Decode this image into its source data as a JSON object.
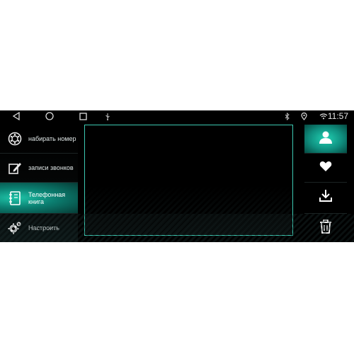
{
  "statusbar": {
    "time": "11:57",
    "icons": [
      "back-icon",
      "home-icon",
      "recent-apps-icon",
      "usb-icon",
      "bluetooth-icon",
      "location-icon",
      "wifi-icon"
    ]
  },
  "menu": {
    "items": [
      {
        "label": "набирать номер",
        "icon": "dialpad-icon",
        "active": false
      },
      {
        "label": "записи звонков",
        "icon": "edit-icon",
        "active": false
      },
      {
        "label": "Телефонная книга",
        "icon": "phonebook-icon",
        "active": true
      },
      {
        "label": "Настроить",
        "icon": "gear-icon",
        "active": false
      }
    ]
  },
  "right_toolbar": {
    "items": [
      {
        "icon": "contact-icon",
        "active": true
      },
      {
        "icon": "heart-icon",
        "active": false
      },
      {
        "icon": "download-icon",
        "active": false
      },
      {
        "icon": "trash-icon",
        "active": false
      }
    ]
  },
  "colors": {
    "accent": "#1fc4a8",
    "panel_border": "#3cc9b2",
    "background": "#000000",
    "text": "#dfe6e6"
  }
}
